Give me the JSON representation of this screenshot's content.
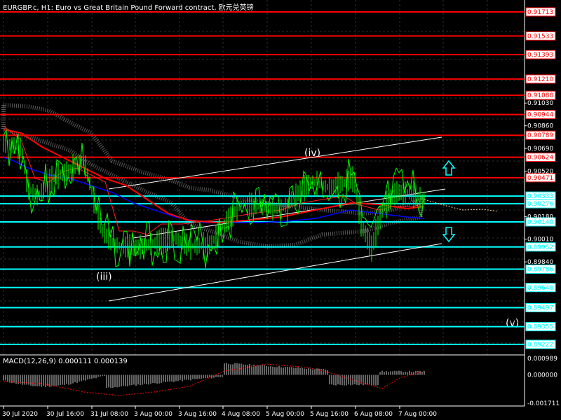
{
  "window": {
    "title": "EURGBP.c, H1:  Euro vs Great Britain Pound Forward contract, 欧元兑英镑"
  },
  "chart_data": {
    "type": "candlestick",
    "symbol": "EURGBP.c",
    "timeframe": "H1",
    "ylim": [
      0.891,
      0.918
    ],
    "y_ticks": [
      "0.91030",
      "0.90860",
      "0.90690",
      "0.90520",
      "0.90180",
      "0.90010",
      "0.89840"
    ],
    "x_ticks": [
      "30 Jul 2020",
      "30 Jul 16:00",
      "31 Jul 08:00",
      "3 Aug 00:00",
      "3 Aug 16:00",
      "4 Aug 08:00",
      "5 Aug 00:00",
      "5 Aug 16:00",
      "6 Aug 08:00",
      "7 Aug 00:00"
    ],
    "red_levels": [
      "0.91713",
      "0.91533",
      "0.91393",
      "0.91210",
      "0.91088",
      "0.90944",
      "0.90789",
      "0.90624",
      "0.90471"
    ],
    "cyan_levels": [
      "0.90333",
      "0.90276",
      "0.90140",
      "0.89952",
      "0.89786",
      "0.89648",
      "0.89497",
      "0.89355",
      "0.89222"
    ],
    "wave_labels": [
      "(iii)",
      "(iv)",
      "(v)"
    ],
    "arrow_up_color": "#00ffff",
    "arrow_down_color": "#00ffff",
    "colors": {
      "candles": "#00ff00",
      "red_levels": "#ff0000",
      "cyan_levels": "#00ffff",
      "ma_slow": "#ff0000",
      "ma_fast": "#0000ff",
      "cloud": "#ffffff"
    },
    "macd": {
      "label": "MACD(12,26,9) 0.000111 0.000139",
      "ticks": [
        "0.000989",
        "0.000000",
        "-0.001711"
      ],
      "ylim": [
        -0.001711,
        0.000989
      ]
    }
  }
}
